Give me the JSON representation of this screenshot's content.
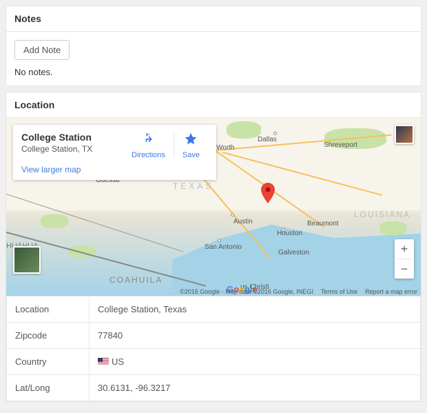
{
  "notes": {
    "header": "Notes",
    "addBtn": "Add Note",
    "empty": "No notes."
  },
  "location": {
    "header": "Location",
    "card": {
      "title": "College Station",
      "subtitle": "College Station, TX",
      "directions": "Directions",
      "save": "Save",
      "viewLarger": "View larger map"
    },
    "cities": {
      "dallas": "Dallas",
      "ftworth": "Worth",
      "shreveport": "Shreveport",
      "odessa": "Odessa",
      "austin": "Austin",
      "sanantonio": "San Antonio",
      "houston": "Houston",
      "beaumont": "Beaumont",
      "galveston": "Galveston",
      "corpus": "us Christi",
      "huahua": "HUAHUA",
      "coahuila": "COAHUILA"
    },
    "regions": {
      "texas": "TEXAS",
      "louisiana": "LOUISIANA"
    },
    "zoom": {
      "in": "+",
      "out": "−"
    },
    "attribution": {
      "copyright": "©2016 Google - Map data ©2016 Google, INEGI",
      "terms": "Terms of Use",
      "report": "Report a map error"
    },
    "details": {
      "locationLabel": "Location",
      "locationValue": "College Station, Texas",
      "zipLabel": "Zipcode",
      "zipValue": "77840",
      "countryLabel": "Country",
      "countryValue": "US",
      "latlongLabel": "Lat/Long",
      "latlongValue": "30.6131, -96.3217"
    }
  }
}
